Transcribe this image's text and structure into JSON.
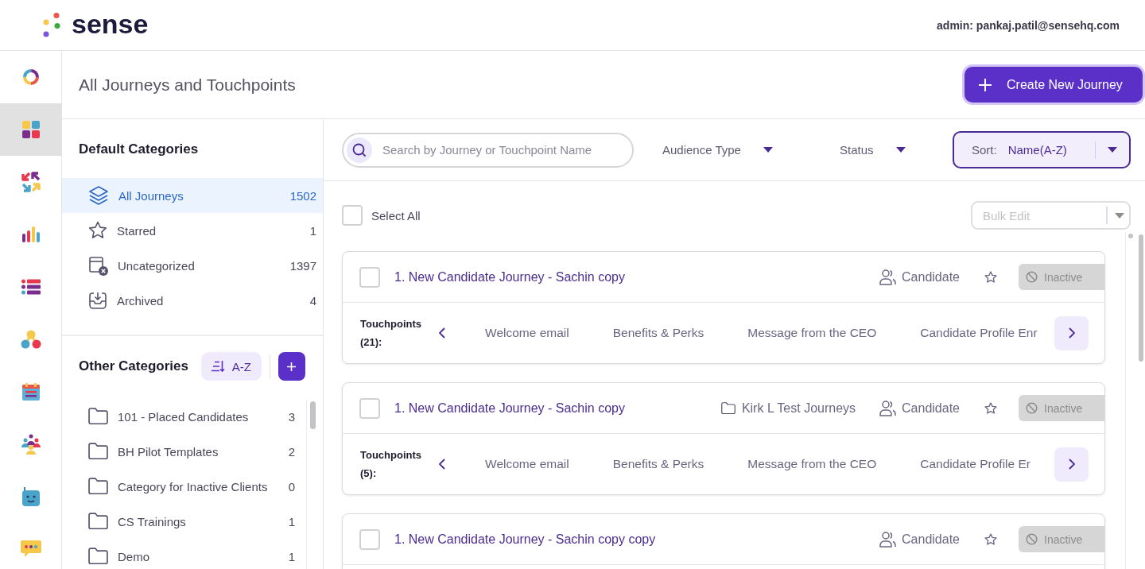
{
  "header": {
    "logo_text": "sense",
    "user": "admin: pankaj.patil@sensehq.com"
  },
  "rail": {
    "items": [
      {
        "kind": "ring",
        "selected": false
      },
      {
        "kind": "grid",
        "selected": true
      },
      {
        "kind": "arrows",
        "selected": false
      },
      {
        "kind": "bars",
        "selected": false
      },
      {
        "kind": "list",
        "selected": false
      },
      {
        "kind": "nodes",
        "selected": false
      },
      {
        "kind": "calendar",
        "selected": false
      },
      {
        "kind": "people",
        "selected": false
      },
      {
        "kind": "robot",
        "selected": false
      },
      {
        "kind": "chat",
        "selected": false
      }
    ]
  },
  "page": {
    "title": "All Journeys and Touchpoints",
    "create_button": "Create New Journey"
  },
  "default_categories": {
    "heading": "Default Categories",
    "items": [
      {
        "kind": "layers",
        "label": "All Journeys",
        "count": "1502",
        "selected": true
      },
      {
        "kind": "star",
        "label": "Starred",
        "count": "1",
        "selected": false
      },
      {
        "kind": "uncategorized",
        "label": "Uncategorized",
        "count": "1397",
        "selected": false
      },
      {
        "kind": "archive",
        "label": "Archived",
        "count": "4",
        "selected": false
      }
    ]
  },
  "other_categories": {
    "heading": "Other Categories",
    "sort_button": "A-Z",
    "items": [
      {
        "label": "101 - Placed Candidates",
        "count": "3",
        "selected": false
      },
      {
        "label": "BH Pilot Templates",
        "count": "2",
        "selected": false
      },
      {
        "label": "Category for Inactive Clients",
        "count": "0",
        "selected": false
      },
      {
        "label": "CS Trainings",
        "count": "1",
        "selected": false
      },
      {
        "label": "Demo",
        "count": "1",
        "selected": false
      }
    ]
  },
  "toolbar": {
    "search": {
      "placeholder": "Search by Journey or Touchpoint Name"
    },
    "filters": [
      {
        "label": "Audience Type"
      },
      {
        "label": "Status"
      }
    ],
    "sort": {
      "label": "Sort:",
      "value": "Name(A-Z)"
    }
  },
  "list": {
    "select_all": {
      "label": "Select All",
      "checked": false
    },
    "bulk_edit": {
      "label": "Bulk Edit",
      "disabled": true
    },
    "journeys": [
      {
        "title": "1. New Candidate Journey - Sachin copy",
        "checked": false,
        "audience": "Candidate",
        "starred": false,
        "status": "Inactive",
        "active": false,
        "touchpoints": {
          "label": "Touchpoints (21):",
          "items": [
            "Welcome email",
            "Benefits & Perks",
            "Message from the CEO",
            "Candidate Profile Enr"
          ]
        }
      },
      {
        "title": "1. New Candidate Journey - Sachin copy",
        "checked": false,
        "folder": "Kirk L Test Journeys",
        "audience": "Candidate",
        "starred": false,
        "status": "Inactive",
        "active": false,
        "touchpoints": {
          "label": "Touchpoints (5):",
          "items": [
            "Welcome email",
            "Benefits & Perks",
            "Message from the CEO",
            "Candidate Profile Er"
          ]
        }
      },
      {
        "title": "1. New Candidate Journey - Sachin copy copy",
        "checked": false,
        "audience": "Candidate",
        "starred": false,
        "status": "Inactive",
        "active": false
      }
    ]
  }
}
